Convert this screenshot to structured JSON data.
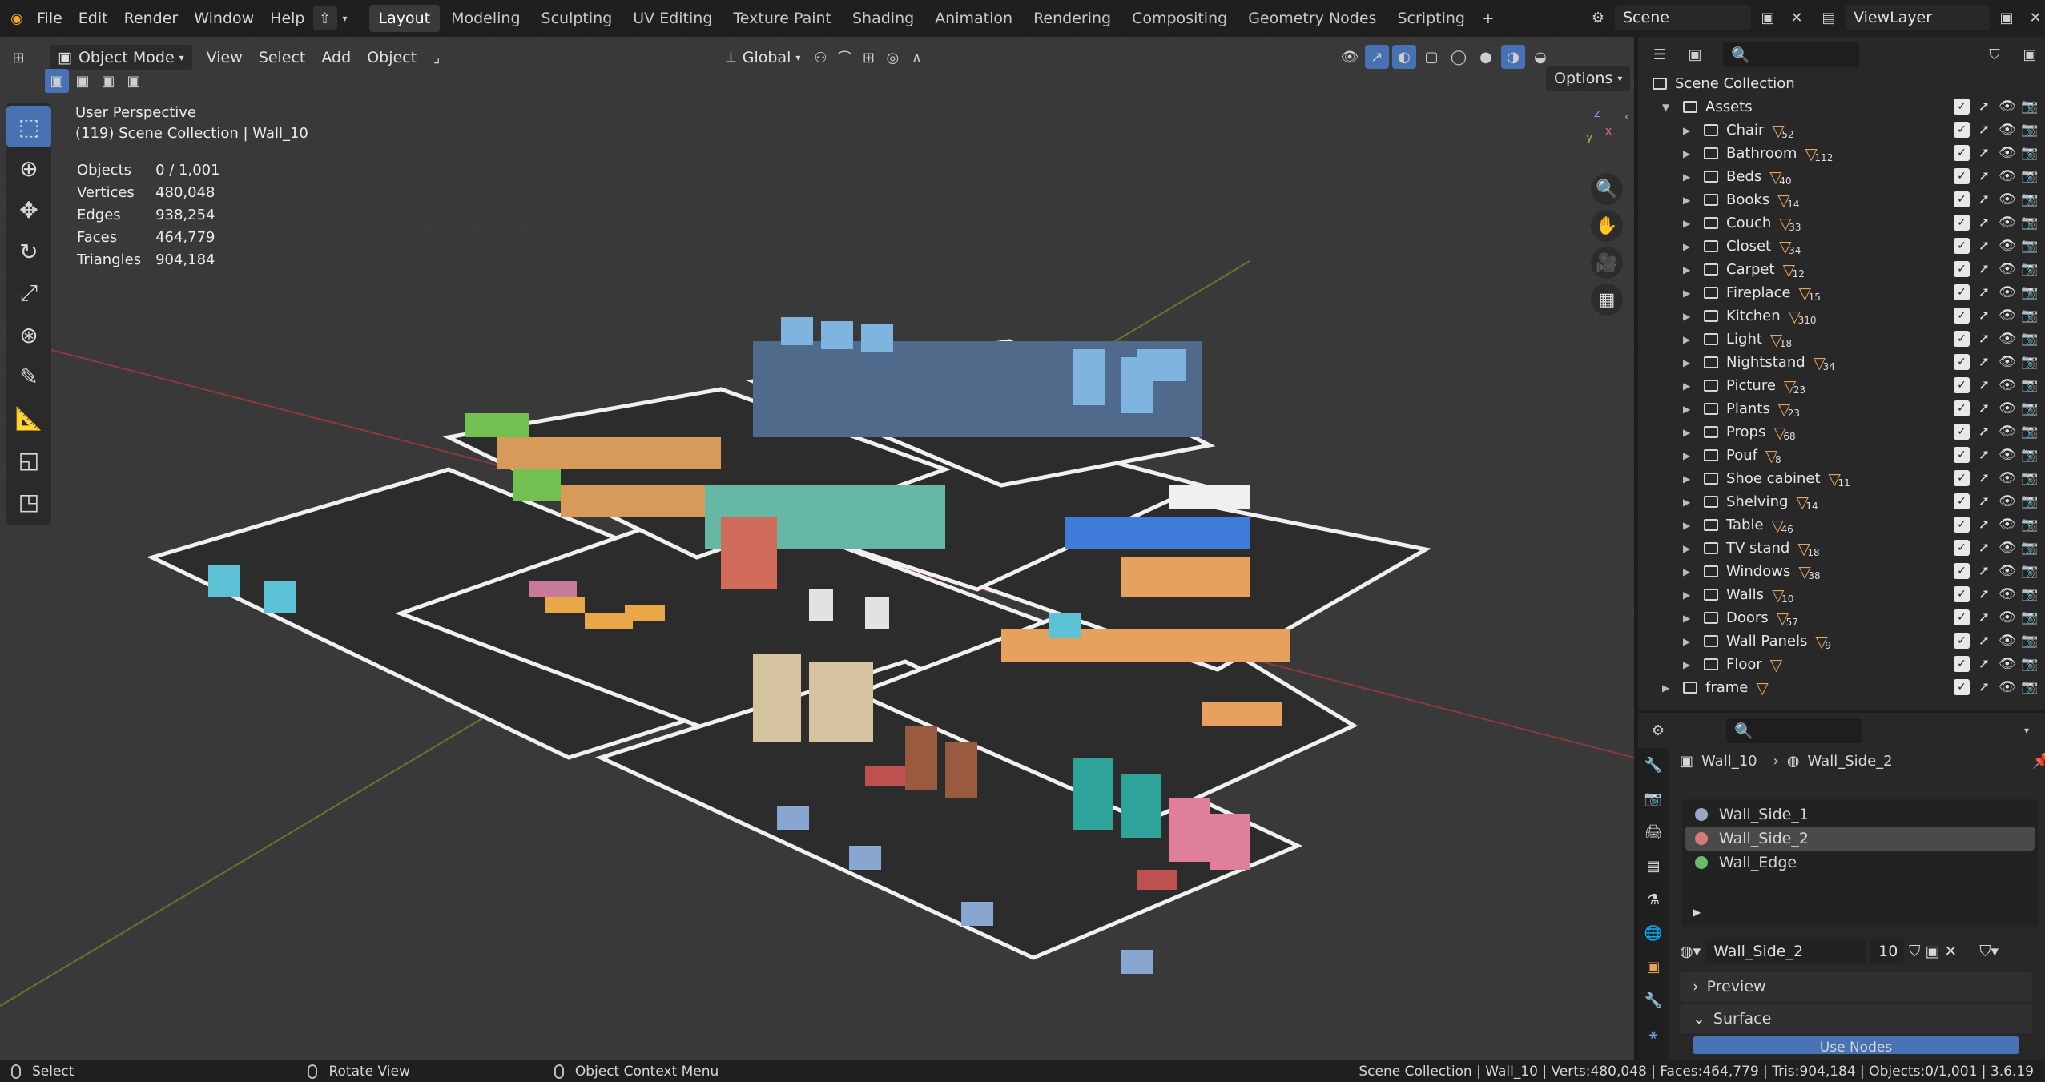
{
  "topbar": {
    "menus": [
      "File",
      "Edit",
      "Render",
      "Window",
      "Help"
    ],
    "workspaces": [
      "Layout",
      "Modeling",
      "Sculpting",
      "UV Editing",
      "Texture Paint",
      "Shading",
      "Animation",
      "Rendering",
      "Compositing",
      "Geometry Nodes",
      "Scripting"
    ],
    "active_workspace": "Layout",
    "scene": "Scene",
    "view_layer": "ViewLayer"
  },
  "viewport": {
    "mode": "Object Mode",
    "menus": [
      "View",
      "Select",
      "Add",
      "Object"
    ],
    "transform": "Global",
    "options_label": "Options",
    "perspective": "User Perspective",
    "collection_info": "(119) Scene Collection | Wall_10",
    "stats": [
      {
        "label": "Objects",
        "value": "0 / 1,001"
      },
      {
        "label": "Vertices",
        "value": "480,048"
      },
      {
        "label": "Edges",
        "value": "938,254"
      },
      {
        "label": "Faces",
        "value": "464,779"
      },
      {
        "label": "Triangles",
        "value": "904,184"
      }
    ]
  },
  "outliner": {
    "root": "Scene Collection",
    "assets_label": "Assets",
    "children": [
      {
        "name": "Chair",
        "count": "52"
      },
      {
        "name": "Bathroom",
        "count": "112"
      },
      {
        "name": "Beds",
        "count": "40"
      },
      {
        "name": "Books",
        "count": "14"
      },
      {
        "name": "Couch",
        "count": "33"
      },
      {
        "name": "Closet",
        "count": "34"
      },
      {
        "name": "Carpet",
        "count": "12"
      },
      {
        "name": "Fireplace",
        "count": "15"
      },
      {
        "name": "Kitchen",
        "count": "310"
      },
      {
        "name": "Light",
        "count": "18"
      },
      {
        "name": "Nightstand",
        "count": "34"
      },
      {
        "name": "Picture",
        "count": "23"
      },
      {
        "name": "Plants",
        "count": "23"
      },
      {
        "name": "Props",
        "count": "68"
      },
      {
        "name": "Pouf",
        "count": "8"
      },
      {
        "name": "Shoe cabinet",
        "count": "11"
      },
      {
        "name": "Shelving",
        "count": "14"
      },
      {
        "name": "Table",
        "count": "46"
      },
      {
        "name": "TV stand",
        "count": "18"
      },
      {
        "name": "Windows",
        "count": "38"
      },
      {
        "name": "Walls",
        "count": "10"
      },
      {
        "name": "Doors",
        "count": "57"
      },
      {
        "name": "Wall Panels",
        "count": "9"
      },
      {
        "name": "Floor",
        "count": ""
      }
    ],
    "frame_label": "frame"
  },
  "properties": {
    "object": "Wall_10",
    "material": "Wall_Side_2",
    "slots": [
      {
        "name": "Wall_Side_1",
        "color": "#9aa7c4"
      },
      {
        "name": "Wall_Side_2",
        "color": "#d57a7a"
      },
      {
        "name": "Wall_Edge",
        "color": "#6dbb6d"
      }
    ],
    "selected_slot": "Wall_Side_2",
    "users": "10",
    "panels": [
      "Preview",
      "Surface"
    ],
    "use_nodes": "Use Nodes"
  },
  "statusbar": {
    "left": "Select",
    "middle": "Rotate View",
    "right": "Object Context Menu",
    "info": "Scene Collection | Wall_10 | Verts:480,048 | Faces:464,779 | Tris:904,184 | Objects:0/1,001 | 3.6.19"
  },
  "colors": {
    "accent": "#4772b3",
    "filter_orange": "#e7a35b"
  }
}
